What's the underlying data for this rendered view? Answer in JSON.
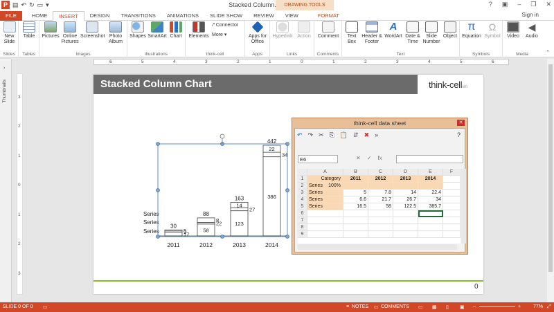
{
  "window": {
    "title": "Stacked Column.pptx - PowerPoint",
    "context_group": "DRAWING TOOLS",
    "sign_in": "Sign in"
  },
  "tabs": [
    "FILE",
    "HOME",
    "INSERT",
    "DESIGN",
    "TRANSITIONS",
    "ANIMATIONS",
    "SLIDE SHOW",
    "REVIEW",
    "VIEW",
    "FORMAT"
  ],
  "active_tab": "INSERT",
  "ribbon": {
    "new_slide": "New Slide",
    "table": "Table",
    "pictures": "Pictures",
    "online_pictures": "Online Pictures",
    "screenshot": "Screenshot",
    "photo_album": "Photo Album",
    "shapes": "Shapes",
    "smartart": "SmartArt",
    "chart": "Chart",
    "elements": "Elements",
    "connector": "Connector",
    "more": "More",
    "apps_for_office": "Apps for Office",
    "hyperlink": "Hyperlink",
    "action": "Action",
    "comment": "Comment",
    "text_box": "Text Box",
    "header_footer": "Header & Footer",
    "wordart": "WordArt",
    "date_time": "Date & Time",
    "slide_number": "Slide Number",
    "object": "Object",
    "equation": "Equation",
    "symbol": "Symbol",
    "video": "Video",
    "audio": "Audio",
    "groups": {
      "slides": "Slides",
      "tables": "Tables",
      "images": "Images",
      "illustrations": "Illustrations",
      "thinkcell": "think-cell",
      "apps": "Apps",
      "links": "Links",
      "comments": "Comments",
      "text": "Text",
      "symbols": "Symbols",
      "media": "Media"
    }
  },
  "ruler_numbers": [
    "6",
    "5",
    "4",
    "3",
    "2",
    "1",
    "0",
    "1",
    "2",
    "3",
    "4",
    "5",
    "6"
  ],
  "vruler_numbers": [
    "3",
    "2",
    "1",
    "0",
    "1",
    "2",
    "3"
  ],
  "thumbnails_label": "Thumbnails",
  "slide": {
    "title": "Stacked Column Chart",
    "logo": "think-cell",
    "logo_suffix": "sm",
    "page_number": "0"
  },
  "chart_data": {
    "type": "bar",
    "categories": [
      "2011",
      "2012",
      "2013",
      "2014"
    ],
    "series": [
      {
        "values": [
          5,
          22,
          27,
          34
        ]
      },
      {
        "values": [
          7.8,
          8,
          14,
          22.4
        ]
      },
      {
        "values": [
          16.5,
          58,
          122.5,
          385.7
        ]
      }
    ],
    "totals": [
      "30",
      "88",
      "163",
      "442"
    ],
    "segment_labels": [
      [
        "17",
        "9",
        "5"
      ],
      [
        "58",
        "22",
        "8"
      ],
      [
        "123",
        "27",
        "14"
      ],
      [
        "386",
        "34",
        "22"
      ]
    ],
    "legend_labels": [
      "Series",
      "Series",
      "Series"
    ],
    "ylim": [
      0,
      442
    ]
  },
  "datasheet": {
    "title": "think-cell data sheet",
    "help": "?",
    "name_box": "E6",
    "columns": [
      "A",
      "B",
      "C",
      "D",
      "E",
      "F"
    ],
    "rows": [
      {
        "num": "1",
        "a": "Category",
        "b": "2011",
        "c": "2012",
        "d": "2013",
        "e": "2014"
      },
      {
        "num": "2",
        "a": "Series",
        "a2": "100%",
        "b": "",
        "c": "",
        "d": "",
        "e": ""
      },
      {
        "num": "3",
        "a": "Series",
        "b": "5",
        "c": "7.8",
        "d": "14",
        "e": "22.4"
      },
      {
        "num": "4",
        "a": "Series",
        "b": "6.6",
        "c": "21.7",
        "d": "26.7",
        "e": "34"
      },
      {
        "num": "5",
        "a": "Series",
        "b": "16.5",
        "c": "58",
        "d": "122.5",
        "e": "385.7"
      },
      {
        "num": "6",
        "a": "",
        "b": "",
        "c": "",
        "d": "",
        "e": ""
      },
      {
        "num": "7",
        "a": "",
        "b": "",
        "c": "",
        "d": "",
        "e": ""
      },
      {
        "num": "8",
        "a": "",
        "b": "",
        "c": "",
        "d": "",
        "e": ""
      },
      {
        "num": "9",
        "a": "",
        "b": "",
        "c": "",
        "d": "",
        "e": ""
      }
    ]
  },
  "status": {
    "slide": "SLIDE 0 OF 0",
    "notes": "NOTES",
    "comments": "COMMENTS",
    "zoom": "77%"
  },
  "colors": {
    "accent": "#d24726",
    "title_bar": "#6b6b6b",
    "green_line": "#86bc25",
    "header_fill": "#f9d8b6",
    "selection": "#5b8fc7"
  }
}
